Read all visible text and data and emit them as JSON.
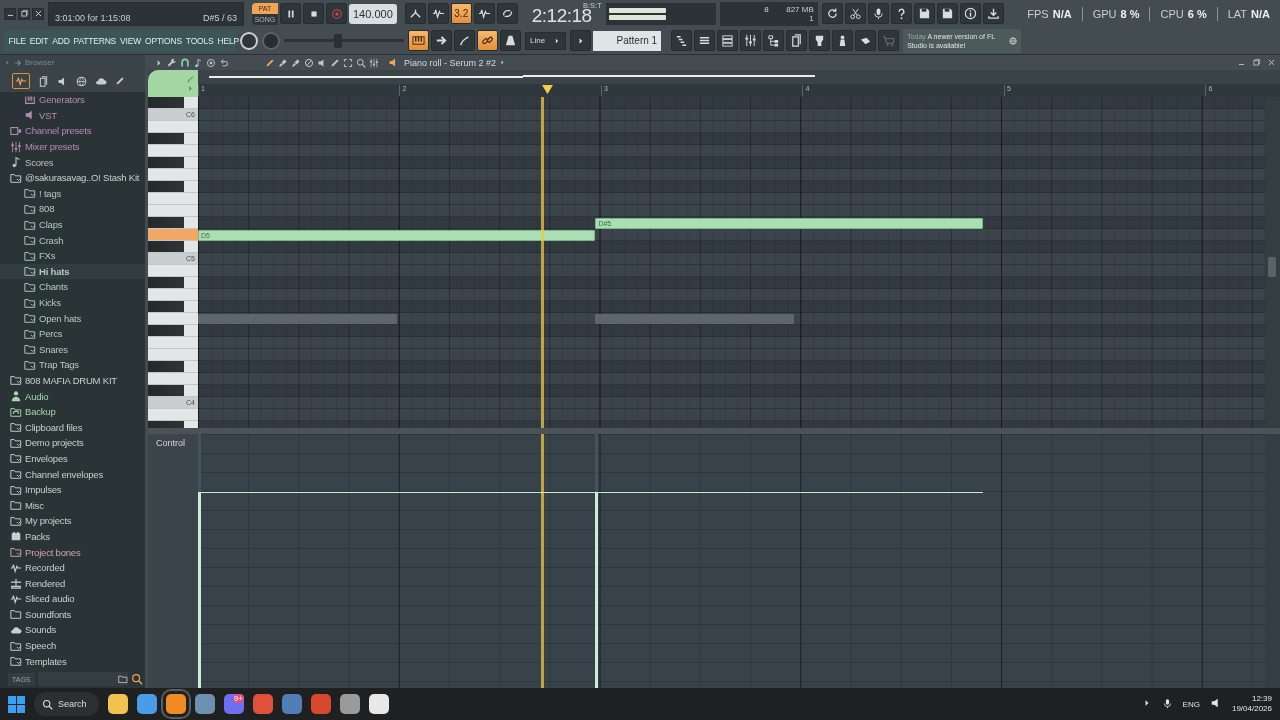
{
  "hint_bar": {
    "line": "3:01:00 for 1:15:08",
    "note": "D#5 / 63"
  },
  "transport": {
    "modes": [
      {
        "label": "PAT",
        "selected": true
      },
      {
        "label": "SONG",
        "selected": false
      }
    ],
    "playing": true,
    "recording": false,
    "tempo": "140.000"
  },
  "song_time": {
    "value": "2:12:18",
    "unit": "B:S:T"
  },
  "monitor": {
    "voices": "8",
    "memory": "827 MB",
    "reading_3": "1"
  },
  "recording_tools": [
    {
      "on": false
    },
    {
      "on": false
    },
    {
      "label": "3.2",
      "on": true
    },
    {
      "on": false
    },
    {
      "on": false
    }
  ],
  "menu": [
    "FILE",
    "EDIT",
    "ADD",
    "PATTERNS",
    "VIEW",
    "OPTIONS",
    "TOOLS",
    "HELP"
  ],
  "master_pitch": {
    "level": 0.45
  },
  "view_tools": [
    {
      "on": true
    },
    {
      "on": false
    },
    {
      "on": false
    },
    {
      "on": true
    },
    {
      "on": false
    }
  ],
  "snap": "Line",
  "pattern": "Pattern 1",
  "news": {
    "when": "Today",
    "message": "A newer version of FL Studio is available!"
  },
  "stats": [
    {
      "label": "FPS",
      "value": "N/A"
    },
    {
      "label": "GPU",
      "value": "8 %"
    },
    {
      "label": "CPU",
      "value": "6 %"
    },
    {
      "label": "LAT",
      "value": "N/A"
    }
  ],
  "browser": {
    "title": "Browser",
    "tree": [
      {
        "children": [
          {
            "label": "Generators",
            "kind": "generator",
            "selected": false
          },
          {
            "label": "VST",
            "kind": "plugin",
            "selected": false
          }
        ]
      },
      {
        "label": "Channel presets",
        "kind": "preset",
        "selected": false
      },
      {
        "label": "Mixer presets",
        "kind": "mixer",
        "selected": false
      },
      {
        "label": "Scores",
        "kind": "note",
        "selected": false
      },
      {
        "label": "@sakurasavag..O! Stash Kit",
        "kind": "folder",
        "selected": false,
        "children": [
          {
            "label": "! tags",
            "kind": "folder",
            "selected": false
          },
          {
            "label": "808",
            "kind": "folder",
            "selected": false
          },
          {
            "label": "Claps",
            "kind": "folder",
            "selected": false
          },
          {
            "label": "Crash",
            "kind": "folder",
            "selected": false
          },
          {
            "label": "FXs",
            "kind": "folder",
            "selected": false
          },
          {
            "label": "Hi hats",
            "kind": "folder",
            "selected": true
          },
          {
            "label": "Chants",
            "kind": "folder",
            "selected": false
          },
          {
            "label": "Kicks",
            "kind": "folder",
            "selected": false
          },
          {
            "label": "Open hats",
            "kind": "folder",
            "selected": false
          },
          {
            "label": "Percs",
            "kind": "folder",
            "selected": false
          },
          {
            "label": "Snares",
            "kind": "folder",
            "selected": false
          },
          {
            "label": "Trap Tags",
            "kind": "folder",
            "selected": false
          }
        ]
      },
      {
        "label": "808 MAFIA DRUM KIT",
        "kind": "folder",
        "selected": false
      },
      {
        "label": "Audio",
        "kind": "user",
        "selected": false
      },
      {
        "label": "Backup",
        "kind": "backup",
        "selected": false
      },
      {
        "label": "Clipboard files",
        "kind": "folder",
        "selected": false
      },
      {
        "label": "Demo projects",
        "kind": "folder",
        "selected": false
      },
      {
        "label": "Envelopes",
        "kind": "folder",
        "selected": false
      },
      {
        "label": "Channel envelopes",
        "kind": "folder",
        "selected": false
      },
      {
        "label": "Impulses",
        "kind": "folder",
        "selected": false
      },
      {
        "label": "Misc",
        "kind": "plain-folder",
        "selected": false
      },
      {
        "label": "My projects",
        "kind": "folder",
        "selected": false
      },
      {
        "label": "Packs",
        "kind": "pack",
        "selected": false
      },
      {
        "label": "Project bones",
        "kind": "bones",
        "selected": false
      },
      {
        "label": "Recorded",
        "kind": "wave",
        "selected": false
      },
      {
        "label": "Rendered",
        "kind": "render",
        "selected": false
      },
      {
        "label": "Sliced audio",
        "kind": "wave",
        "selected": false
      },
      {
        "label": "Soundfonts",
        "kind": "plain-folder",
        "selected": false
      },
      {
        "label": "Sounds",
        "kind": "cloud",
        "selected": false
      },
      {
        "label": "Speech",
        "kind": "folder",
        "selected": false
      },
      {
        "label": "Templates",
        "kind": "folder",
        "selected": false
      }
    ],
    "tags_label": "TAGS"
  },
  "piano_roll": {
    "title": "Piano roll - Serum 2 #2",
    "bars": [
      "1",
      "2",
      "3",
      "4",
      "5",
      "6"
    ],
    "key_labels": [
      "C6",
      "C5",
      "C4"
    ],
    "notes": [
      {
        "label": "D5",
        "level": 0.77,
        "key_highlighted": true
      },
      {
        "label": "D#5",
        "level": 0.77,
        "key_highlighted": false
      }
    ],
    "control_label": "Control"
  },
  "taskbar": {
    "search": "Search",
    "apps": [
      {
        "color": "#f2c14e",
        "active": false
      },
      {
        "color": "#4a9be8",
        "active": false
      },
      {
        "color": "#f08a24",
        "active": true
      },
      {
        "color": "#6d8fb0",
        "active": false
      },
      {
        "color": "#6b6ff0",
        "active": false,
        "badge": "9+"
      },
      {
        "color": "#e0503a",
        "active": false
      },
      {
        "color": "#4f7fb5",
        "active": false
      },
      {
        "color": "#d9482b",
        "active": false
      },
      {
        "color": "#9a9a9a",
        "active": false
      },
      {
        "color": "#e8e8e8",
        "active": false
      }
    ],
    "language": "ENG",
    "time": "12:39",
    "date": "19/04/2026"
  }
}
